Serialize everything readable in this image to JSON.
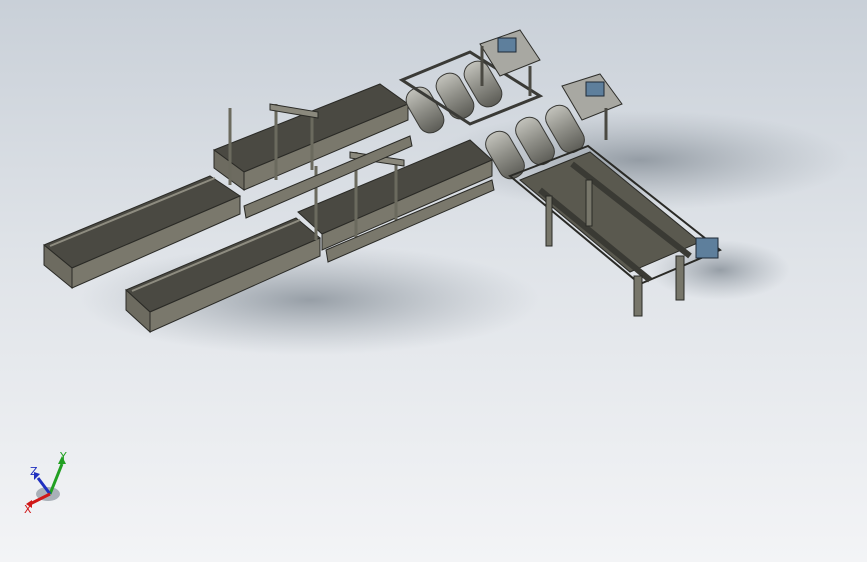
{
  "view": {
    "model": "conveyor-line-assembly",
    "background_top": "#c9d0d8",
    "background_bottom": "#f3f4f6",
    "frame_color": "#6b6a5e",
    "belt_color": "#3b3a34",
    "roller_color": "#9a9a94",
    "motor_color": "#5e7f9c"
  },
  "triad": {
    "x_label": "X",
    "y_label": "Y",
    "z_label": "Z",
    "x_color": "#d01818",
    "y_color": "#22a022",
    "z_color": "#2030c0"
  }
}
